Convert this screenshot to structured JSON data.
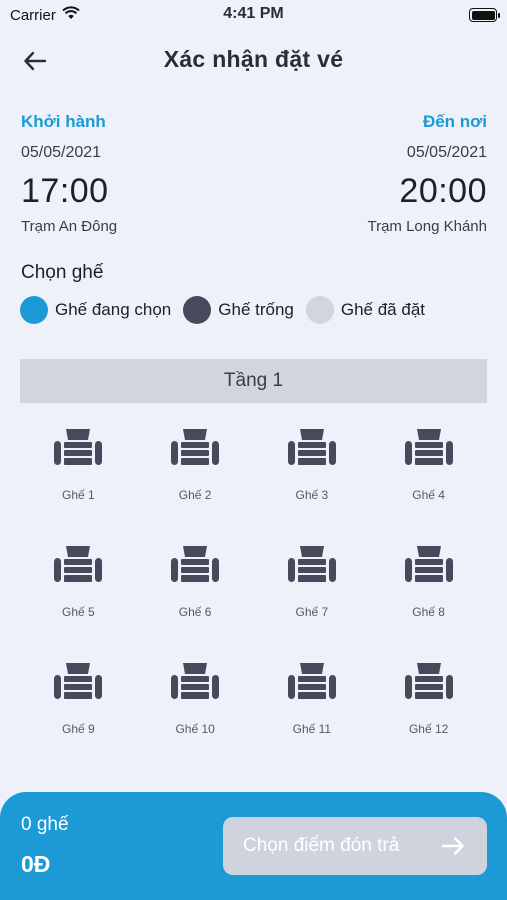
{
  "status_bar": {
    "carrier": "Carrier",
    "time": "4:41 PM"
  },
  "header": {
    "title": "Xác nhận đặt vé",
    "back_icon": "arrow-left-icon"
  },
  "departure": {
    "label": "Khởi hành",
    "date": "05/05/2021",
    "time": "17:00",
    "station": "Trạm An Đông"
  },
  "arrival": {
    "label": "Đến nơi",
    "date": "05/05/2021",
    "time": "20:00",
    "station": "Trạm Long Khánh"
  },
  "seat_section": {
    "title": "Chọn ghế"
  },
  "legend": [
    {
      "label": "Ghế đang chọn",
      "color": "#1C9AD6"
    },
    {
      "label": "Ghế trống",
      "color": "#464A5A"
    },
    {
      "label": "Ghế đã đặt",
      "color": "#D3D5DC"
    }
  ],
  "floor": {
    "label": "Tầng 1"
  },
  "seats": [
    {
      "label": "Ghế 1"
    },
    {
      "label": "Ghế 2"
    },
    {
      "label": "Ghế 3"
    },
    {
      "label": "Ghế 4"
    },
    {
      "label": "Ghế 5"
    },
    {
      "label": "Ghế 6"
    },
    {
      "label": "Ghế 7"
    },
    {
      "label": "Ghế 8"
    },
    {
      "label": "Ghế 9"
    },
    {
      "label": "Ghế 10"
    },
    {
      "label": "Ghế 11"
    },
    {
      "label": "Ghế 12"
    }
  ],
  "footer": {
    "count": "0 ghế",
    "price": "0Đ",
    "button_label": "Chọn điểm đón trả",
    "button_icon": "arrow-right-icon"
  },
  "colors": {
    "accent": "#1C9AD6",
    "seat_empty": "#464A5A",
    "seat_booked": "#D3D5DC",
    "background": "#EEF1F9"
  }
}
